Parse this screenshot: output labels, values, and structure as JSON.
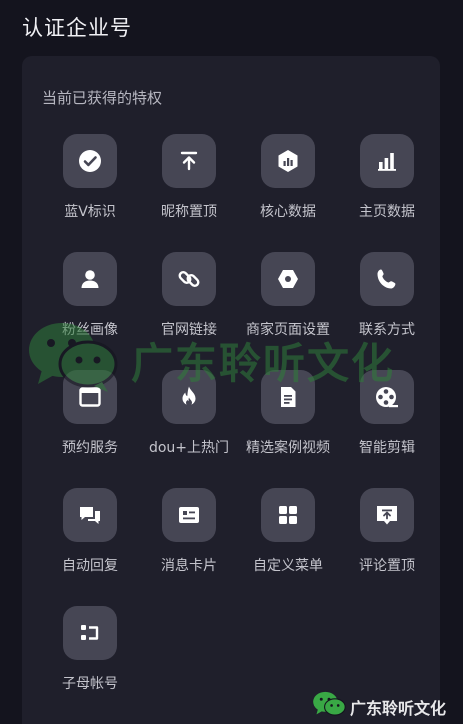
{
  "header": {
    "title": "认证企业号"
  },
  "privileges": {
    "section_title": "当前已获得的特权",
    "items": [
      {
        "label": "蓝V标识",
        "icon": "checkmark-circle-icon"
      },
      {
        "label": "昵称置顶",
        "icon": "pin-to-top-icon"
      },
      {
        "label": "核心数据",
        "icon": "core-data-chart-icon"
      },
      {
        "label": "主页数据",
        "icon": "bar-chart-icon"
      },
      {
        "label": "粉丝画像",
        "icon": "user-profile-icon"
      },
      {
        "label": "官网链接",
        "icon": "link-icon"
      },
      {
        "label": "商家页面设置",
        "icon": "hexagon-settings-icon"
      },
      {
        "label": "联系方式",
        "icon": "phone-icon"
      },
      {
        "label": "预约服务",
        "icon": "browser-window-icon"
      },
      {
        "label": "dou+上热门",
        "icon": "flame-icon"
      },
      {
        "label": "精选案例视频",
        "icon": "document-icon"
      },
      {
        "label": "智能剪辑",
        "icon": "film-reel-icon"
      },
      {
        "label": "自动回复",
        "icon": "chat-bubbles-icon"
      },
      {
        "label": "消息卡片",
        "icon": "message-card-icon"
      },
      {
        "label": "自定义菜单",
        "icon": "grid-menu-icon"
      },
      {
        "label": "评论置顶",
        "icon": "comment-pin-icon"
      },
      {
        "label": "子母帐号",
        "icon": "sub-account-icon"
      }
    ]
  },
  "watermark": {
    "text": "广东聆听文化",
    "color": "#2f7d3a",
    "icon": "wechat-logo-icon"
  }
}
